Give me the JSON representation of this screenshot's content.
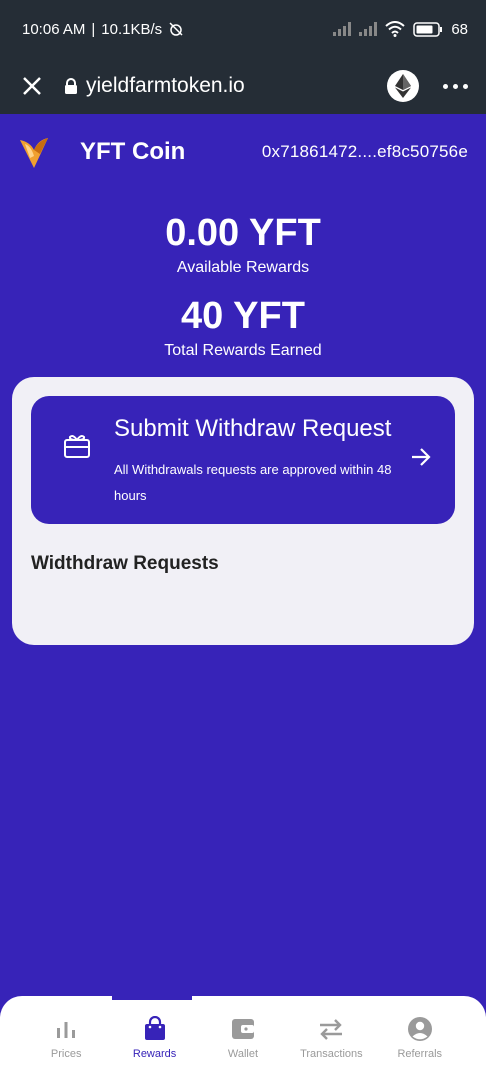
{
  "status": {
    "time": "10:06 AM",
    "speed": "10.1KB/s",
    "battery": "68"
  },
  "browser": {
    "url": "yieldfarmtoken.io"
  },
  "header": {
    "brand": "YFT Coin",
    "wallet_address": "0x71861472....ef8c50756e"
  },
  "rewards": {
    "available_value": "0.00 YFT",
    "available_label": "Available Rewards",
    "total_value": "40 YFT",
    "total_label": "Total Rewards Earned"
  },
  "withdraw": {
    "title": "Submit Withdraw Request",
    "description": "All Withdrawals requests are approved within 48 hours",
    "requests_title": "Widthdraw Requests"
  },
  "nav": {
    "items": [
      {
        "label": "Prices",
        "icon": "bar-chart-icon"
      },
      {
        "label": "Rewards",
        "icon": "shopping-bag-icon"
      },
      {
        "label": "Wallet",
        "icon": "wallet-icon"
      },
      {
        "label": "Transactions",
        "icon": "swap-icon"
      },
      {
        "label": "Referrals",
        "icon": "account-circle-icon"
      }
    ],
    "active": "Rewards"
  },
  "colors": {
    "primary": "#3723b8",
    "card_bg": "#f1f0f6",
    "status_bar": "#252d36",
    "logo_accent": "#f0a030"
  }
}
